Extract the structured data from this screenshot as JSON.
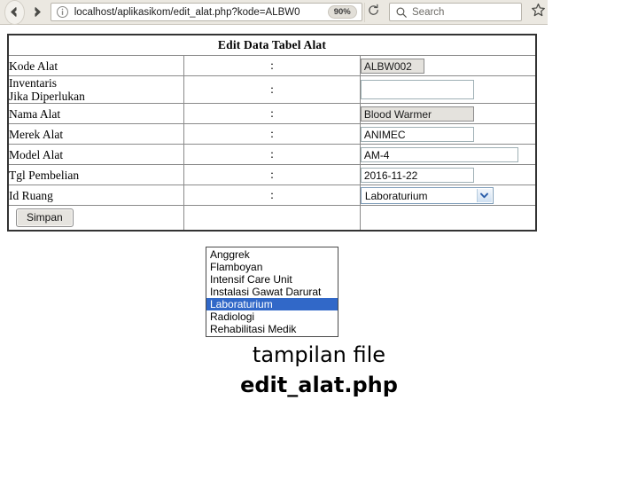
{
  "browser": {
    "back_icon": "arrow-left-icon",
    "forward_icon": "arrow-right-icon",
    "info_icon": "info-circle-icon",
    "url": "localhost/aplikasikom/edit_alat.php?kode=ALBW0",
    "zoom_level": "90%",
    "reload_icon": "reload-icon",
    "search_icon": "search-icon",
    "search_placeholder": "Search",
    "bookmark_icon": "star-icon"
  },
  "form": {
    "title": "Edit Data Tabel Alat",
    "colon": ":",
    "rows": [
      {
        "label": "Kode Alat",
        "value": "ALBW002",
        "type": "text-disabled"
      },
      {
        "label_line1": "Inventaris",
        "label_line2": "Jika Diperlukan",
        "value": "",
        "type": "text"
      },
      {
        "label": "Nama Alat",
        "value": "Blood Warmer",
        "type": "text-disabled"
      },
      {
        "label": "Merek Alat",
        "value": "ANIMEC",
        "type": "text"
      },
      {
        "label": "Model Alat",
        "value": "AM-4",
        "type": "text"
      },
      {
        "label": "Tgl Pembelian",
        "value": "2016-11-22",
        "type": "text"
      },
      {
        "label": "Id Ruang",
        "value": "Laboraturium",
        "type": "select"
      }
    ],
    "submit_label": "Simpan"
  },
  "dropdown": {
    "open": true,
    "selected": "Laboraturium",
    "highlight_color": "#3168c8",
    "options": [
      "Anggrek",
      "Flamboyan",
      "Intensif Care Unit",
      "Instalasi Gawat Darurat",
      "Laboraturium",
      "Radiologi",
      "Rehabilitasi Medik"
    ]
  },
  "caption": {
    "line1": "tampilan file",
    "line2": "edit_alat.php"
  }
}
